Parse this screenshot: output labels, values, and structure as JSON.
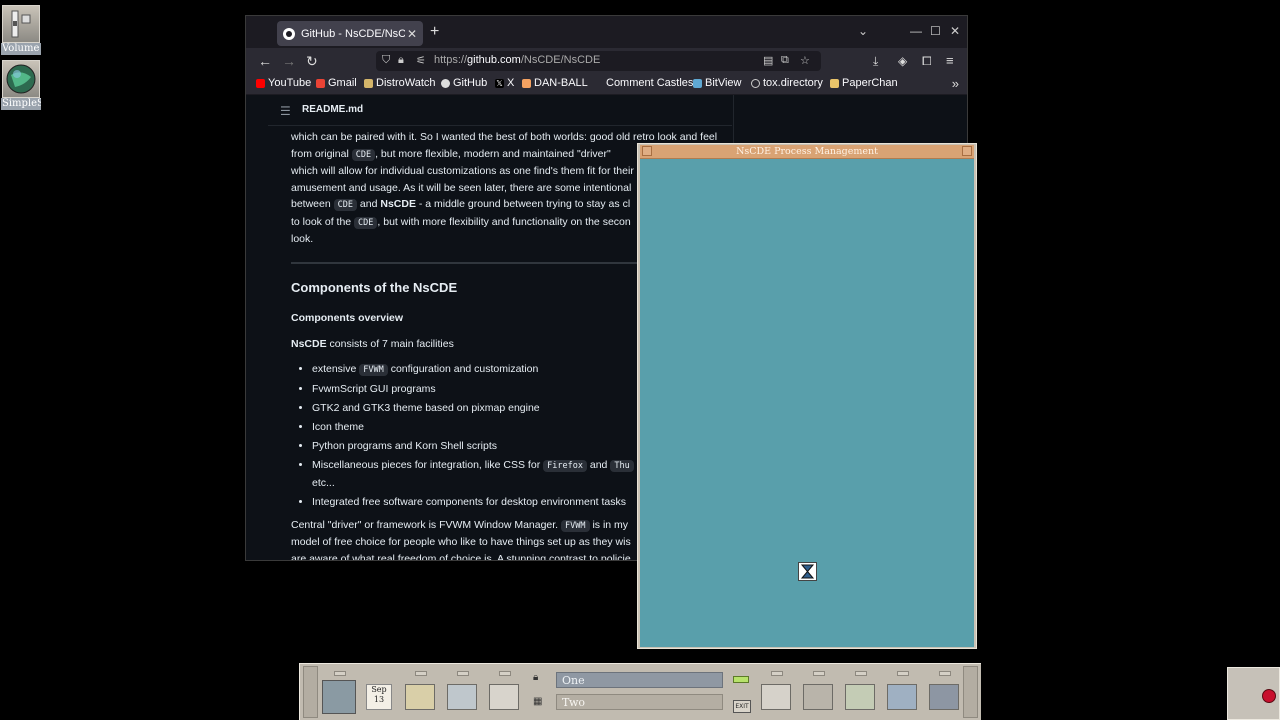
{
  "desktop": {
    "icons": [
      {
        "label": "Volume",
        "icon": "volume-icon"
      },
      {
        "label": "SimpleS",
        "icon": "globe-icon"
      }
    ]
  },
  "browser": {
    "tab_title": "GitHub - NsCDE/NsCDE",
    "url": "https://github.com/NsCDE/NsCDE",
    "url_host": "github.com",
    "url_prefix": "https://",
    "url_path": "/NsCDE/NsCDE",
    "bookmarks": [
      "YouTube",
      "Gmail",
      "DistroWatch",
      "GitHub",
      "X",
      "DAN-BALL",
      "Comment Castles",
      "BitView",
      "tox.directory",
      "PaperChan"
    ]
  },
  "readme": {
    "file": "README.md",
    "intro_1": "which can be paired with it. So I wanted the best of both worlds: good old retro look and feel from original",
    "intro_code_1": "CDE",
    "intro_2": ", but more flexible, modern and maintained \"driver\"",
    "intro_3": "which will allow for individual customizations as one find's them fit for their",
    "intro_4": "amusement and usage. As it will be seen later, there are some intentional",
    "intro_5": "between",
    "intro_code_2": "CDE",
    "intro_6": "and",
    "intro_bold": "NsCDE",
    "intro_7": "- a middle ground between trying to stay as cl",
    "intro_8": "to look of the",
    "intro_code_3": "CDE",
    "intro_9": ", but with more flexibility and functionality on the secon",
    "intro_10": "look.",
    "h2": "Components of the NsCDE",
    "h3": "Components overview",
    "lead_bold": "NsCDE",
    "lead_rest": "consists of 7 main facilities",
    "items": {
      "i1a": "extensive",
      "i1code": "FVWM",
      "i1b": "configuration and customization",
      "i2": "FvwmScript GUI programs",
      "i3": "GTK2 and GTK3 theme based on pixmap engine",
      "i4": "Icon theme",
      "i5": "Python programs and Korn Shell scripts",
      "i6a": "Miscellaneous pieces for integration, like CSS for",
      "i6code1": "Firefox",
      "i6b": "and",
      "i6code2": "Thu",
      "i6c": "etc...",
      "i7": "Integrated free software components for desktop environment tasks"
    },
    "para2_a": "Central \"driver\" or framework is FVWM Window Manager.",
    "para2_code": "FVWM",
    "para2_b": "is in my",
    "para2_c": "model of free choice for people who like to have things set up as they wis",
    "para2_d": "are aware of what real freedom of choice is. A stunning contrast to policie"
  },
  "proc_window": {
    "title": "NsCDE Process Management"
  },
  "panel": {
    "date_month": "Sep",
    "date_day": "13",
    "workspace_1": "One",
    "workspace_2": "Two",
    "exit_label": "EXIT"
  },
  "colors": {
    "proc_body": "#599fab",
    "proc_title": "#d9a374",
    "panel": "#c1bbb0",
    "github_bg": "#0d1117"
  }
}
